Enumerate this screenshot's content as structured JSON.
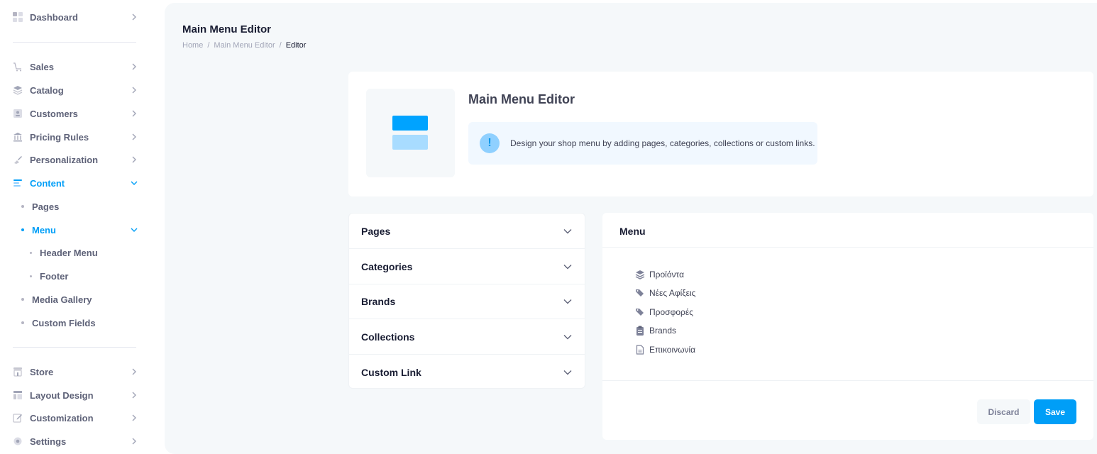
{
  "sidebar": {
    "dashboard": "Dashboard",
    "sales": "Sales",
    "catalog": "Catalog",
    "customers": "Customers",
    "pricing_rules": "Pricing Rules",
    "personalization": "Personalization",
    "content": "Content",
    "pages": "Pages",
    "menu": "Menu",
    "header_menu": "Header Menu",
    "footer": "Footer",
    "media_gallery": "Media Gallery",
    "custom_fields": "Custom Fields",
    "store": "Store",
    "layout_design": "Layout Design",
    "customization": "Customization",
    "settings": "Settings"
  },
  "header": {
    "title": "Main Menu Editor",
    "breadcrumb": {
      "home": "Home",
      "sep1": "/",
      "section": "Main Menu Editor",
      "sep2": "/",
      "current": "Editor"
    }
  },
  "hero": {
    "title": "Main Menu Editor",
    "notice": "Design your shop menu by adding pages, categories, collections or custom links."
  },
  "accordion": {
    "pages": "Pages",
    "categories": "Categories",
    "brands": "Brands",
    "collections": "Collections",
    "custom_link": "Custom Link"
  },
  "menu": {
    "title": "Menu",
    "items": [
      {
        "label": "Προϊόντα",
        "icon": "layers-icon"
      },
      {
        "label": "Νέες Αφίξεις",
        "icon": "tags-icon"
      },
      {
        "label": "Προσφορές",
        "icon": "tags-icon"
      },
      {
        "label": "Brands",
        "icon": "clipboard-icon"
      },
      {
        "label": "Επικοινωνία",
        "icon": "file-icon"
      }
    ],
    "discard": "Discard",
    "save": "Save"
  },
  "colors": {
    "accent": "#009ef7",
    "muted": "#5e6278",
    "surface": "#f5f8fa"
  }
}
